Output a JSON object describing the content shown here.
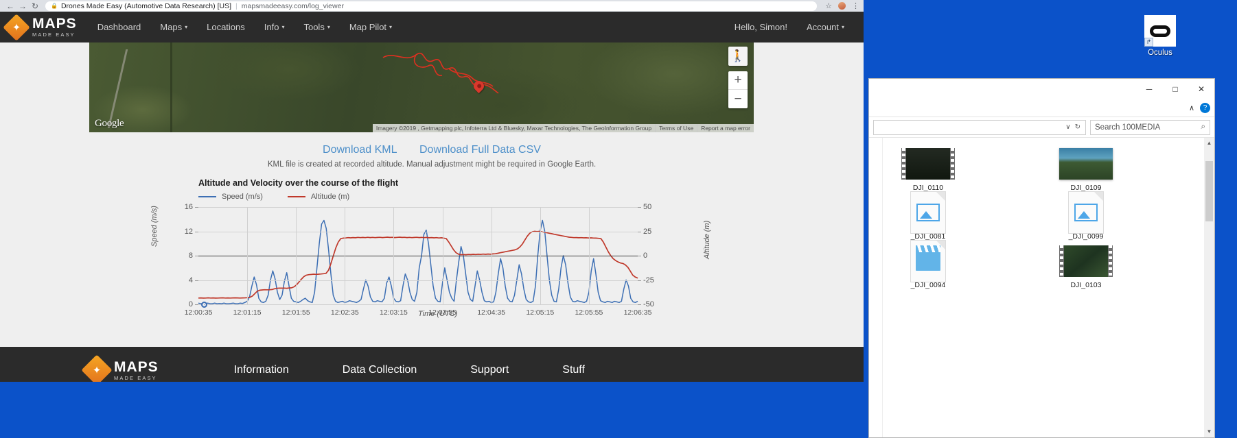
{
  "browser": {
    "back_icon": "←",
    "forward_icon": "→",
    "reload_icon": "↻",
    "lock_icon": "🔒",
    "site_name": "Drones Made Easy (Automotive Data Research) [US]",
    "separator": "|",
    "url": "mapsmadeeasy.com/log_viewer",
    "star_icon": "☆",
    "menu_icon": "⋮"
  },
  "navbar": {
    "brand_main": "MAPS",
    "brand_sub": "MADE EASY",
    "links": [
      {
        "label": "Dashboard",
        "caret": ""
      },
      {
        "label": "Maps",
        "caret": "▾"
      },
      {
        "label": "Locations",
        "caret": ""
      },
      {
        "label": "Info",
        "caret": "▾"
      },
      {
        "label": "Tools",
        "caret": "▾"
      },
      {
        "label": "Map Pilot",
        "caret": "▾"
      }
    ],
    "greeting": "Hello, Simon!",
    "account": "Account",
    "account_caret": "▾"
  },
  "map": {
    "google_logo": "Google",
    "pegman_icon": "🚶",
    "zoom_in": "+",
    "zoom_out": "−",
    "attribution": [
      "Imagery ©2019 , Getmapping plc, Infoterra Ltd & Bluesky, Maxar Technologies, The GeoInformation Group",
      "Terms of Use",
      "Report a map error"
    ]
  },
  "downloads": {
    "kml_label": "Download KML",
    "csv_label": "Download Full Data CSV",
    "note": "KML file is created at recorded altitude. Manual adjustment might be required in Google Earth."
  },
  "chart_data": {
    "type": "line",
    "title": "Altitude and Velocity over the course of the flight",
    "xlabel": "Time (UTC)",
    "ylabel": "Speed (m/s)",
    "y2label": "Altitude (m)",
    "grid": true,
    "legend_position": "top-left",
    "ylim": [
      0,
      16
    ],
    "y2lim": [
      -50,
      50
    ],
    "yticks": [
      "16",
      "12",
      "8",
      "4",
      "0"
    ],
    "y2ticks": [
      "50",
      "25",
      "0",
      "-25",
      "-50"
    ],
    "xticks": [
      "12:00:35",
      "12:01:15",
      "12:01:55",
      "12:02:35",
      "12:03:15",
      "12:03:55",
      "12:04:35",
      "12:05:15",
      "12:05:55",
      "12:06:35"
    ],
    "series": [
      {
        "name": "Speed (m/s)",
        "color": "#3d6fb4",
        "axis": "left",
        "values": [
          0.2,
          0.1,
          0.15,
          0.1,
          0.2,
          0.1,
          0.1,
          0.2,
          0.1,
          0.15,
          0.1,
          0.2,
          0.1,
          0.1,
          0.15,
          0.2,
          0.1,
          0.1,
          0.2,
          0.15,
          0.3,
          0.5,
          1.2,
          3.0,
          4.5,
          3.2,
          1.0,
          0.4,
          0.3,
          0.5,
          1.5,
          4.0,
          5.5,
          4.2,
          2.0,
          0.8,
          1.5,
          3.8,
          5.2,
          3.0,
          1.0,
          0.5,
          0.4,
          0.3,
          0.5,
          0.8,
          1.0,
          0.6,
          0.4,
          0.3,
          2.0,
          6.0,
          10.0,
          13.2,
          13.8,
          12.5,
          9.0,
          5.0,
          1.5,
          0.5,
          0.3,
          0.4,
          0.5,
          0.3,
          0.4,
          0.6,
          0.5,
          0.4,
          0.3,
          0.5,
          0.8,
          2.5,
          4.0,
          3.0,
          1.2,
          0.5,
          0.4,
          0.6,
          0.5,
          0.4,
          1.0,
          3.5,
          4.5,
          3.0,
          1.0,
          0.5,
          0.4,
          0.6,
          3.0,
          5.0,
          4.0,
          2.0,
          0.8,
          0.5,
          2.0,
          6.0,
          8.0,
          11.5,
          12.2,
          10.0,
          6.5,
          3.0,
          1.0,
          0.5,
          0.4,
          3.5,
          6.0,
          4.0,
          2.0,
          1.0,
          0.5,
          4.0,
          7.0,
          9.5,
          8.0,
          5.0,
          2.0,
          0.8,
          0.5,
          3.0,
          5.5,
          4.0,
          2.0,
          0.6,
          0.4,
          0.5,
          0.3,
          0.4,
          2.0,
          5.0,
          7.5,
          6.0,
          3.0,
          1.0,
          0.5,
          0.4,
          1.5,
          4.0,
          6.5,
          5.0,
          2.5,
          0.8,
          0.4,
          0.3,
          0.5,
          3.0,
          8.0,
          12.0,
          13.8,
          12.0,
          8.0,
          4.0,
          1.5,
          0.5,
          0.4,
          2.5,
          6.0,
          8.0,
          6.5,
          3.5,
          1.2,
          0.5,
          0.4,
          0.6,
          0.5,
          0.4,
          0.3,
          0.5,
          2.0,
          5.5,
          7.5,
          5.0,
          2.0,
          0.6,
          0.4,
          0.3,
          0.5,
          0.4,
          0.3,
          0.5,
          0.4,
          0.3,
          0.5,
          2.5,
          4.0,
          3.0,
          1.0,
          0.4,
          0.3,
          0.5
        ]
      },
      {
        "name": "Altitude (m)",
        "color": "#c0392b",
        "axis": "right",
        "values": [
          -43.5,
          -43.4,
          -43.6,
          -43.5,
          -43.3,
          -43.5,
          -43.4,
          -43.6,
          -43.5,
          -43.4,
          -43.3,
          -43.5,
          -43.4,
          -43.5,
          -43.4,
          -43.3,
          -43.4,
          -43.5,
          -43.4,
          -43.3,
          -43.2,
          -42.8,
          -41.5,
          -39.0,
          -36.5,
          -35.5,
          -35.2,
          -35.0,
          -35.1,
          -35.0,
          -34.8,
          -34.0,
          -33.5,
          -33.3,
          -33.4,
          -33.3,
          -33.5,
          -33.2,
          -33.0,
          -32.0,
          -30.0,
          -27.0,
          -24.0,
          -21.5,
          -20.0,
          -19.5,
          -19.3,
          -19.0,
          -19.2,
          -19.0,
          -18.8,
          -18.5,
          -18.2,
          -15.0,
          -8.0,
          0.0,
          8.0,
          14.0,
          17.5,
          18.0,
          18.2,
          18.5,
          18.3,
          18.6,
          18.4,
          18.8,
          18.5,
          18.7,
          18.5,
          18.9,
          18.6,
          18.8,
          18.5,
          18.7,
          18.9,
          18.6,
          18.8,
          19.0,
          18.7,
          18.9,
          18.6,
          18.8,
          19.0,
          18.7,
          18.9,
          18.6,
          18.8,
          18.5,
          18.7,
          18.9,
          18.6,
          18.8,
          18.5,
          18.7,
          18.4,
          18.6,
          18.3,
          18.5,
          18.2,
          18.4,
          18.0,
          17.5,
          14.0,
          10.0,
          6.0,
          3.0,
          1.5,
          1.0,
          1.2,
          1.0,
          1.3,
          1.1,
          1.4,
          1.2,
          1.5,
          1.3,
          1.6,
          1.4,
          1.7,
          1.5,
          1.8,
          2.0,
          2.5,
          3.0,
          3.5,
          4.0,
          4.5,
          5.0,
          5.5,
          6.0,
          7.0,
          9.0,
          12.0,
          16.0,
          20.0,
          23.0,
          24.5,
          25.0,
          24.8,
          25.0,
          24.5,
          24.0,
          23.5,
          23.0,
          22.5,
          22.0,
          21.5,
          21.0,
          20.5,
          20.0,
          19.5,
          19.0,
          18.8,
          18.5,
          18.6,
          18.4,
          18.5,
          18.3,
          18.4,
          18.2,
          18.3,
          18.1,
          18.0,
          17.8,
          17.5,
          14.0,
          9.0,
          4.0,
          0.0,
          -3.0,
          -5.0,
          -6.5,
          -7.5,
          -8.0,
          -9.5,
          -12.0,
          -16.0,
          -20.0,
          -22.0,
          -23.0
        ]
      }
    ]
  },
  "footer": {
    "brand_main": "MAPS",
    "brand_sub": "MADE EASY",
    "links": [
      "Information",
      "Data Collection",
      "Support",
      "Stuff"
    ]
  },
  "desktop": {
    "oculus_label": "Oculus",
    "shortcut_arrow": "↱"
  },
  "explorer": {
    "minimize_icon": "─",
    "maximize_icon": "□",
    "close_icon": "✕",
    "ribbon_caret": "∧",
    "help_icon": "?",
    "addr_caret": "∨",
    "refresh_icon": "↻",
    "search_placeholder": "Search 100MEDIA",
    "search_icon": "⌕",
    "scroll_up": "▲",
    "scroll_down": "▼",
    "files": [
      {
        "name": "DJI_0110",
        "kind": "video-dark"
      },
      {
        "name": "DJI_0109",
        "kind": "photo-sky"
      },
      {
        "name": "_DJI_0081",
        "kind": "image-doc"
      },
      {
        "name": "_DJI_0099",
        "kind": "image-doc"
      },
      {
        "name": "_DJI_0094",
        "kind": "clapper-doc"
      },
      {
        "name": "DJI_0103",
        "kind": "video-green"
      }
    ]
  }
}
